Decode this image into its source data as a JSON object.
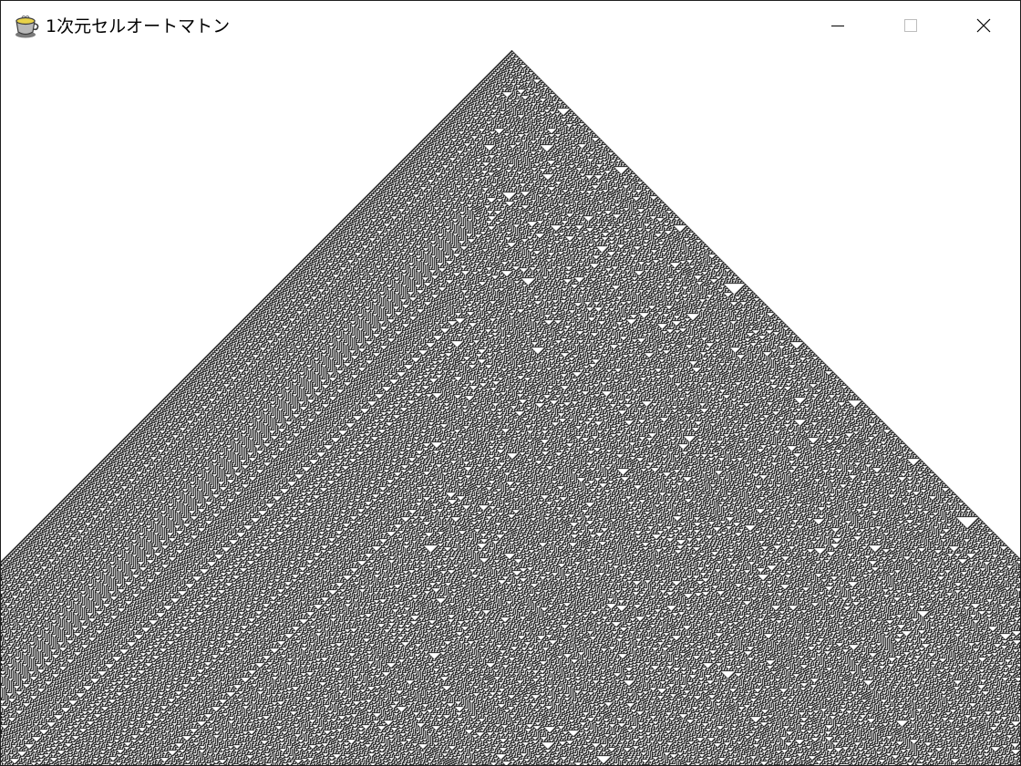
{
  "window": {
    "title": "1次元セルオートマトン",
    "app_icon": "teacup-icon",
    "controls": [
      "minimize-icon",
      "maximize-icon",
      "close-icon"
    ]
  },
  "automaton": {
    "rule": 30,
    "generations": 785,
    "alive_color": "#000000",
    "dead_color": "#ffffff"
  }
}
